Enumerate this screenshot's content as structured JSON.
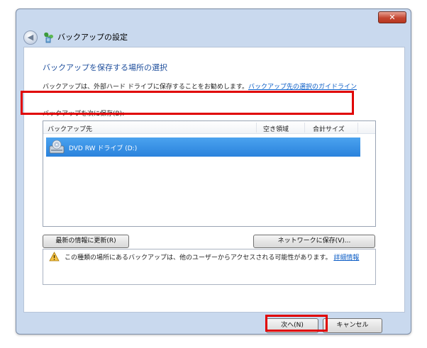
{
  "window": {
    "title": "バックアップの設定",
    "close_label": "✕",
    "back_label": "◀"
  },
  "main": {
    "heading": "バックアップを保存する場所の選択",
    "description": "バックアップは、外部ハード ドライブに保存することをお勧めします。",
    "guideline_link": "バックアップ先の選択のガイドライン",
    "save_label": "バックアップを次に保存(B):"
  },
  "list": {
    "columns": [
      "バックアップ先",
      "空き領域",
      "合計サイズ"
    ],
    "rows": [
      {
        "name": "DVD RW ドライブ (D:)",
        "free": "",
        "total": "",
        "selected": true
      }
    ]
  },
  "buttons": {
    "refresh": "最新の情報に更新(R)",
    "network": "ネットワークに保存(V)...",
    "next": "次へ(N)",
    "cancel": "キャンセル"
  },
  "warning": {
    "text": "この種類の場所にあるバックアップは、他のユーザーからアクセスされる可能性があります。",
    "link": "詳細情報"
  },
  "colors": {
    "highlight": "#e00000",
    "selection": "#3391e6",
    "link": "#0b5cc5",
    "heading": "#1e4e9c"
  }
}
